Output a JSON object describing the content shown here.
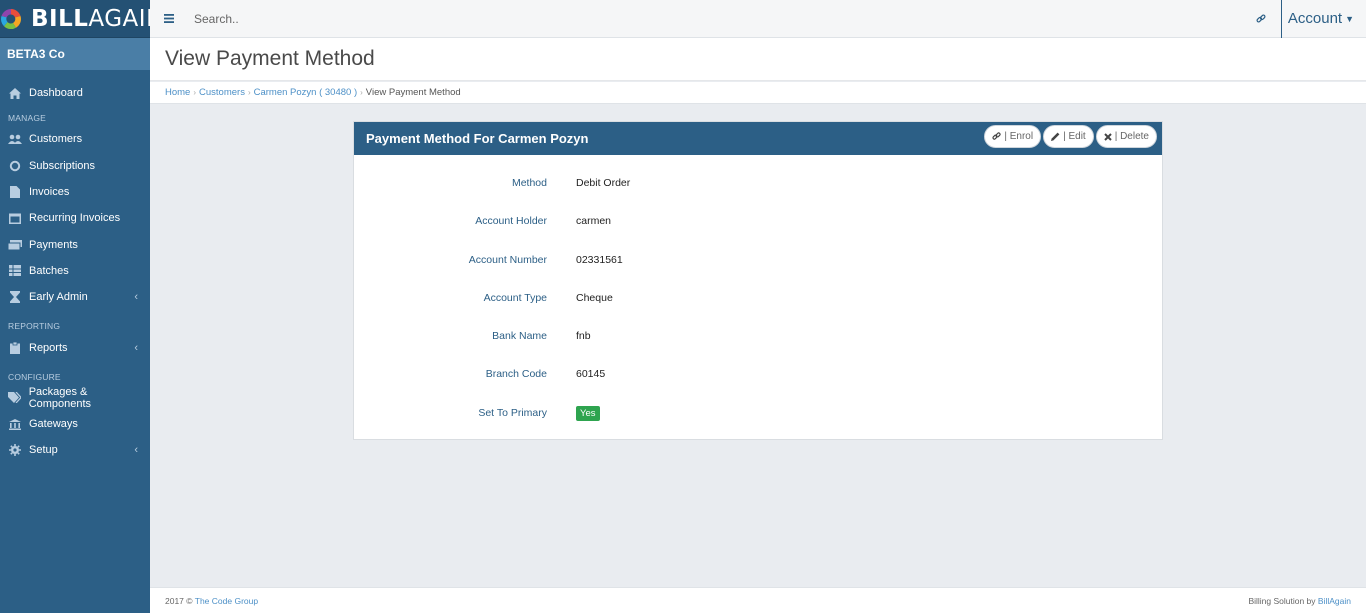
{
  "brand": {
    "logo_bold": "BILL",
    "logo_light": "AGAIN",
    "company": "BETA3 Co"
  },
  "sidebar": {
    "dashboard": "Dashboard",
    "section_manage": "MANAGE",
    "section_reporting": "REPORTING",
    "section_configure": "CONFIGURE",
    "items": {
      "customers": "Customers",
      "subscriptions": "Subscriptions",
      "invoices": "Invoices",
      "recurring_invoices": "Recurring Invoices",
      "payments": "Payments",
      "batches": "Batches",
      "early_admin": "Early Admin",
      "reports": "Reports",
      "packages": "Packages & Components",
      "gateways": "Gateways",
      "setup": "Setup"
    }
  },
  "topbar": {
    "search_placeholder": "Search..",
    "account": "Account"
  },
  "page": {
    "title": "View Payment Method"
  },
  "breadcrumb": {
    "home": "Home",
    "customers": "Customers",
    "customer": "Carmen Pozyn ( 30480 )",
    "current": "View Payment Method"
  },
  "card": {
    "title": "Payment Method For Carmen Pozyn",
    "enrol": "| Enrol",
    "edit": "| Edit",
    "delete": "| Delete",
    "fields": [
      {
        "label": "Method",
        "value": "Debit Order"
      },
      {
        "label": "Account Holder",
        "value": "carmen"
      },
      {
        "label": "Account Number",
        "value": "02331561"
      },
      {
        "label": "Account Type",
        "value": "Cheque"
      },
      {
        "label": "Bank Name",
        "value": "fnb"
      },
      {
        "label": "Branch Code",
        "value": "60145"
      },
      {
        "label": "Set To Primary",
        "value": "Yes"
      }
    ]
  },
  "footer": {
    "copyright": "2017 ©",
    "company": "The Code Group",
    "billing": "Billing Solution by",
    "billing_link": "BillAgain"
  },
  "colors": {
    "sidebar": "#2c5f86",
    "accent_link": "#4d90c7",
    "success": "#2ea44f"
  }
}
